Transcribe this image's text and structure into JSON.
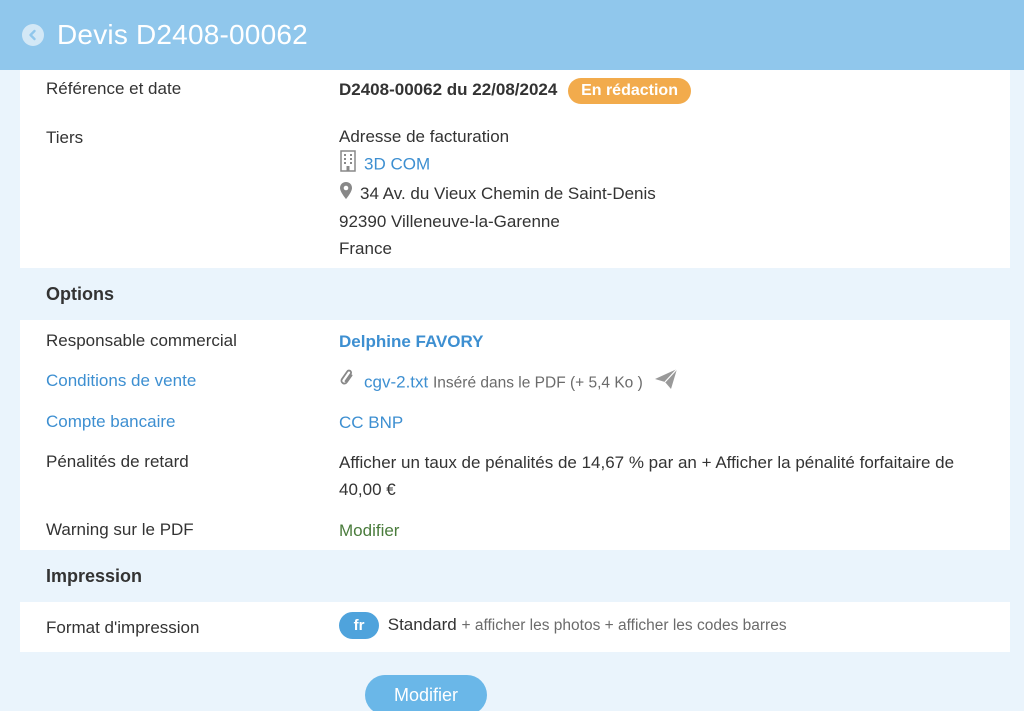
{
  "header": {
    "title": "Devis D2408-00062"
  },
  "ref": {
    "label": "Référence et date",
    "value": "D2408-00062 du 22/08/2024",
    "status": "En rédaction"
  },
  "tiers": {
    "label": "Tiers",
    "address_title": "Adresse de facturation",
    "company": "3D COM",
    "street": "34 Av. du Vieux Chemin de Saint-Denis",
    "city": "92390 Villeneuve-la-Garenne",
    "country": "France"
  },
  "options": {
    "title": "Options",
    "responsable_label": "Responsable commercial",
    "responsable_value": "Delphine FAVORY",
    "conditions_label": "Conditions de vente",
    "conditions_file": "cgv-2.txt",
    "conditions_note": "Inséré dans le PDF (+ 5,4 Ko )",
    "compte_label": "Compte bancaire",
    "compte_value": "CC BNP",
    "penalites_label": "Pénalités de retard",
    "penalites_line1": "Afficher un taux de pénalités de 14,67 % par an + Afficher la pénalité forfaitaire de",
    "penalites_line2": "40,00 €",
    "warning_label": "Warning sur le PDF",
    "warning_value": "Modifier"
  },
  "impression": {
    "title": "Impression",
    "format_label": "Format d'impression",
    "lang": "fr",
    "format_value": "Standard",
    "format_extra": "+ afficher les photos + afficher les codes barres"
  },
  "actions": {
    "modify_label": "Modifier"
  },
  "colors": {
    "header": "#90c7ec",
    "link": "#3d8fd1",
    "badge": "#f2ab4c",
    "button": "#6ab7e8"
  }
}
